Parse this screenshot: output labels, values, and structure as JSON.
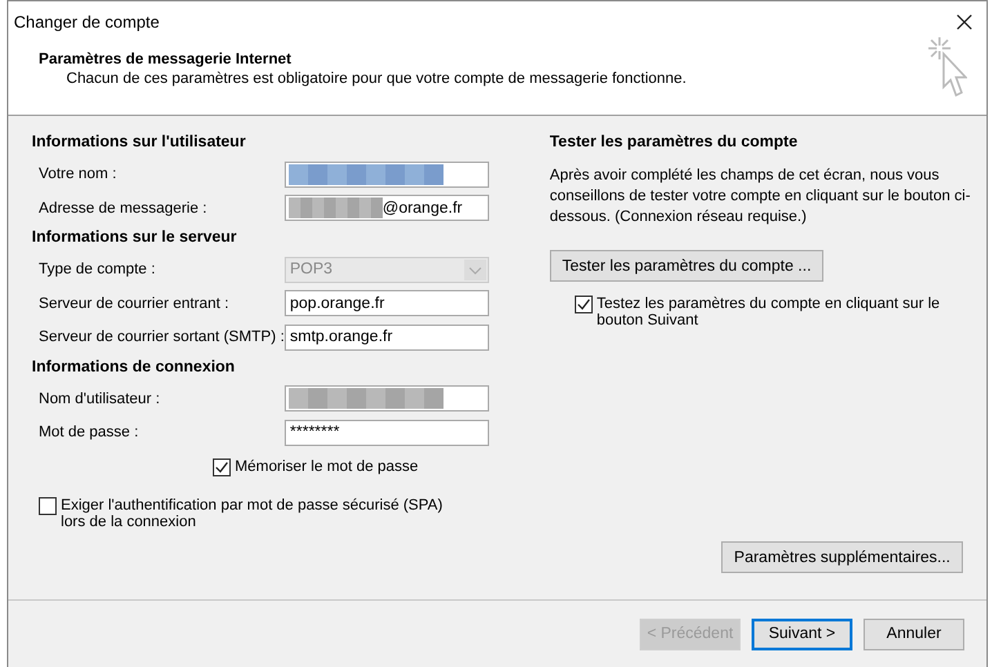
{
  "window": {
    "title": "Changer de compte"
  },
  "header": {
    "title": "Paramètres de messagerie Internet",
    "subtitle": "Chacun de ces paramètres est obligatoire pour que votre compte de messagerie fonctionne."
  },
  "sections": [
    {
      "heading": "Informations sur l'utilisateur",
      "fields": [
        {
          "label": "Votre nom :",
          "kind": "redacted"
        },
        {
          "label": "Adresse de messagerie :",
          "kind": "redacted",
          "value": "@orange.fr"
        }
      ]
    },
    {
      "heading": "Informations sur le serveur",
      "fields": [
        {
          "label": "Type de compte :",
          "kind": "select",
          "value": "POP3",
          "disabled": true
        },
        {
          "label": "Serveur de courrier entrant :",
          "kind": "text",
          "value": "pop.orange.fr"
        },
        {
          "label": "Serveur de courrier sortant (SMTP) :",
          "kind": "text",
          "value": "smtp.orange.fr"
        }
      ]
    },
    {
      "heading": "Informations de connexion",
      "fields": [
        {
          "label": "Nom d'utilisateur :",
          "kind": "redacted"
        },
        {
          "label": "Mot de passe :",
          "kind": "text",
          "value": "********"
        }
      ]
    }
  ],
  "remember_password": {
    "label": "Mémoriser le mot de passe",
    "checked": true
  },
  "spa": {
    "label": "Exiger l'authentification par mot de passe sécurisé (SPA) lors de la connexion",
    "checked": false
  },
  "test": {
    "heading": "Tester les paramètres du compte",
    "description": "Après avoir complété les champs de cet écran, nous vous conseillons de tester votre compte en cliquant sur le bouton ci-dessous. (Connexion réseau requise.)",
    "button": "Tester les paramètres du compte ...",
    "test_on_next": {
      "label": "Testez les paramètres du compte en cliquant sur le bouton Suivant",
      "checked": true
    }
  },
  "more_settings_button": "Paramètres supplémentaires...",
  "footer_buttons": [
    {
      "label": "< Précédent",
      "disabled": true,
      "default": false
    },
    {
      "label": "Suivant >",
      "disabled": false,
      "default": true
    },
    {
      "label": "Annuler",
      "disabled": false,
      "default": false
    }
  ]
}
